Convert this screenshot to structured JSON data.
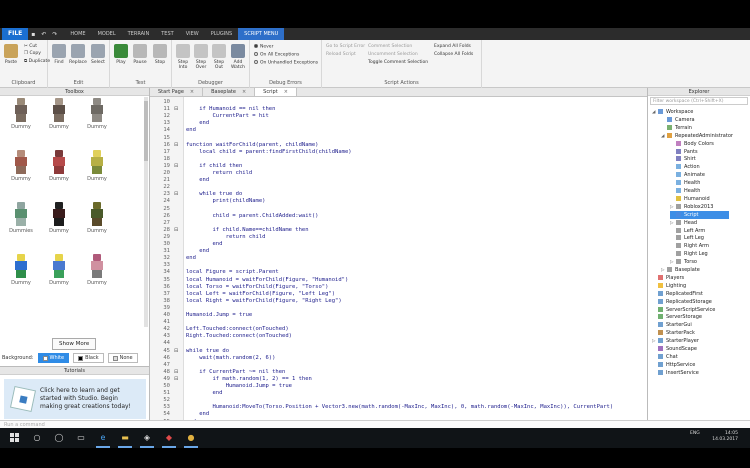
{
  "menubar": {
    "file_label": "FILE",
    "tabs": [
      "HOME",
      "MODEL",
      "TERRAIN",
      "TEST",
      "VIEW",
      "PLUGINS",
      "SCRIPT MENU"
    ]
  },
  "ribbon": {
    "clipboard": {
      "title": "Clipboard",
      "paste": "Paste",
      "cut": "Cut",
      "copy": "Copy",
      "duplicate": "Duplicate"
    },
    "edit": {
      "title": "Edit",
      "find": "Find",
      "replace": "Replace",
      "select": "Select"
    },
    "test": {
      "title": "Test",
      "play": "Play",
      "pause": "Pause",
      "stop": "Stop"
    },
    "debugger": {
      "title": "Debugger",
      "step_into": "Step Into",
      "step_over": "Step Over",
      "step_out": "Step Out",
      "add_watch": "Add Watch"
    },
    "debug_errors": {
      "title": "Debug Errors",
      "never": "Never",
      "on_all": "On All Exceptions",
      "on_unhandled": "On Unhandled Exceptions"
    },
    "actions": {
      "title": "Script Actions",
      "goto": "Go to Script Error",
      "reload": "Reload Script",
      "comment": "Comment Selection",
      "uncomment": "Uncomment Selection",
      "toggle": "Toggle Comment Selection",
      "expand": "Expand All Folds",
      "collapse": "Collapse All Folds"
    }
  },
  "toolbox": {
    "title": "Toolbox",
    "items": [
      {
        "label": "Dummy",
        "head": "#9a8a78",
        "torso": "#6e6058",
        "legs": "#7a6c60"
      },
      {
        "label": "Dummy",
        "head": "#a59688",
        "torso": "#5c4f47",
        "legs": "#7a6c60"
      },
      {
        "label": "Dummy",
        "head": "#8e8a84",
        "torso": "#6e6a64",
        "legs": "#8e8a84"
      },
      {
        "label": "Dummy",
        "head": "#b58c7a",
        "torso": "#a0584a",
        "legs": "#8d6a5a"
      },
      {
        "label": "Dummy",
        "head": "#7a3a3a",
        "torso": "#b64a4a",
        "legs": "#8e3a3a"
      },
      {
        "label": "Dummy",
        "head": "#e0d05a",
        "torso": "#b7b045",
        "legs": "#7a8a3a"
      },
      {
        "label": "Dummies",
        "head": "#8fa5a0",
        "torso": "#5a9070",
        "legs": "#9ab0a8"
      },
      {
        "label": "Dummy",
        "head": "#202020",
        "torso": "#3a1c1c",
        "legs": "#1c1c1c"
      },
      {
        "label": "Dummy",
        "head": "#6a6a2a",
        "torso": "#4a5a2a",
        "legs": "#5a4a2a"
      },
      {
        "label": "Dummy",
        "head": "#e6d44a",
        "torso": "#2e6fcf",
        "legs": "#2e8e4a"
      },
      {
        "label": "Dummy",
        "head": "#e6d44a",
        "torso": "#4a7ad0",
        "legs": "#3aa05a"
      },
      {
        "label": "Dummy",
        "head": "#b05a7a",
        "torso": "#d090a0",
        "legs": "#7a7a7a"
      }
    ],
    "show_more": "Show More",
    "background_label": "Background:",
    "bg_options": [
      "White",
      "Black",
      "None"
    ]
  },
  "tutorials": {
    "title": "Tutorials",
    "text": "Click here to learn and get started with Studio. Begin making great creations today!"
  },
  "editor": {
    "tabs": [
      {
        "label": "Start Page",
        "active": false
      },
      {
        "label": "Baseplate",
        "active": false
      },
      {
        "label": "Script",
        "active": true
      }
    ],
    "first_line": 10,
    "lines": [
      "",
      "    if Humanoid == nil then",
      "        CurrentPart = hit",
      "    end",
      "end",
      "",
      "function waitForChild(parent, childName)",
      "    local child = parent:findFirstChild(childName)",
      "",
      "    if child then",
      "        return child",
      "    end",
      "",
      "    while true do",
      "        print(childName)",
      "",
      "        child = parent.ChildAdded:wait()",
      "",
      "        if child.Name==childName then",
      "            return child",
      "        end",
      "    end",
      "end",
      "",
      "local Figure = script.Parent",
      "local Humanoid = waitForChild(Figure, \"Humanoid\")",
      "local Torso = waitForChild(Figure, \"Torso\")",
      "local Left = waitForChild(Figure, \"Left Leg\")",
      "local Right = waitForChild(Figure, \"Right Leg\")",
      "",
      "Humanoid.Jump = true",
      "",
      "Left.Touched:connect(onTouched)",
      "Right.Touched:connect(onTouched)",
      "",
      "while true do",
      "    wait(math.random(2, 6))",
      "",
      "    if CurrentPart ~= nil then",
      "        if math.random(1, 2) == 1 then",
      "            Humanoid.Jump = true",
      "        end",
      "",
      "        Humanoid:MoveTo(Torso.Position + Vector3.new(math.random(-MaxInc, MaxInc), 0, math.random(-MaxInc, MaxInc)), CurrentPart)",
      "    end",
      "end",
      ""
    ]
  },
  "explorer": {
    "title": "Explorer",
    "filter_placeholder": "Filter workspace (Ctrl+Shift+X)",
    "items": [
      {
        "label": "Workspace",
        "depth": 0,
        "exp": "◢",
        "color": "#6a9ad8"
      },
      {
        "label": "Camera",
        "depth": 1,
        "exp": "",
        "color": "#6a9ad8"
      },
      {
        "label": "Terrain",
        "depth": 1,
        "exp": "",
        "color": "#7ab070"
      },
      {
        "label": "RepeatedAdministrator",
        "depth": 1,
        "exp": "◢",
        "color": "#e0a040"
      },
      {
        "label": "Body Colors",
        "depth": 2,
        "exp": "",
        "color": "#c080c0"
      },
      {
        "label": "Pants",
        "depth": 2,
        "exp": "",
        "color": "#8080c0"
      },
      {
        "label": "Shirt",
        "depth": 2,
        "exp": "",
        "color": "#8080c0"
      },
      {
        "label": "Action",
        "depth": 2,
        "exp": "",
        "color": "#7ab0e0"
      },
      {
        "label": "Animate",
        "depth": 2,
        "exp": "",
        "color": "#7ab0e0"
      },
      {
        "label": "Health",
        "depth": 2,
        "exp": "",
        "color": "#7ab0e0"
      },
      {
        "label": "Health",
        "depth": 2,
        "exp": "",
        "color": "#7ab0e0"
      },
      {
        "label": "Humanoid",
        "depth": 2,
        "exp": "",
        "color": "#e0c040"
      },
      {
        "label": "Roblox2013",
        "depth": 2,
        "exp": "▷",
        "color": "#a0a0a0"
      },
      {
        "label": "Script",
        "depth": 2,
        "exp": "",
        "color": "#4a8ae0",
        "sel": true
      },
      {
        "label": "Head",
        "depth": 2,
        "exp": "▷",
        "color": "#a0a0a0"
      },
      {
        "label": "Left Arm",
        "depth": 2,
        "exp": "",
        "color": "#a0a0a0"
      },
      {
        "label": "Left Leg",
        "depth": 2,
        "exp": "",
        "color": "#a0a0a0"
      },
      {
        "label": "Right Arm",
        "depth": 2,
        "exp": "",
        "color": "#a0a0a0"
      },
      {
        "label": "Right Leg",
        "depth": 2,
        "exp": "",
        "color": "#a0a0a0"
      },
      {
        "label": "Torso",
        "depth": 2,
        "exp": "▷",
        "color": "#a0a0a0"
      },
      {
        "label": "Baseplate",
        "depth": 1,
        "exp": "▷",
        "color": "#a0a0a0"
      },
      {
        "label": "Players",
        "depth": 0,
        "exp": "",
        "color": "#e07070"
      },
      {
        "label": "Lighting",
        "depth": 0,
        "exp": "",
        "color": "#f0c040"
      },
      {
        "label": "ReplicatedFirst",
        "depth": 0,
        "exp": "",
        "color": "#70a0d0"
      },
      {
        "label": "ReplicatedStorage",
        "depth": 0,
        "exp": "",
        "color": "#70a0d0"
      },
      {
        "label": "ServerScriptService",
        "depth": 0,
        "exp": "",
        "color": "#70b070"
      },
      {
        "label": "ServerStorage",
        "depth": 0,
        "exp": "",
        "color": "#70b070"
      },
      {
        "label": "StarterGui",
        "depth": 0,
        "exp": "",
        "color": "#70a0d0"
      },
      {
        "label": "StarterPack",
        "depth": 0,
        "exp": "",
        "color": "#c09050"
      },
      {
        "label": "StarterPlayer",
        "depth": 0,
        "exp": "▷",
        "color": "#70a0d0"
      },
      {
        "label": "SoundScape",
        "depth": 0,
        "exp": "",
        "color": "#a070c0"
      },
      {
        "label": "Chat",
        "depth": 0,
        "exp": "",
        "color": "#70a0d0"
      },
      {
        "label": "HttpService",
        "depth": 0,
        "exp": "",
        "color": "#70a0d0"
      },
      {
        "label": "InsertService",
        "depth": 0,
        "exp": "",
        "color": "#70a0d0"
      }
    ]
  },
  "command_bar": {
    "placeholder": "Run a command"
  },
  "taskbar": {
    "icons": [
      "search-icon",
      "cortana-icon",
      "task-view-icon",
      "edge-icon",
      "folder-icon",
      "store-icon",
      "studio-icon",
      "chrome-icon"
    ],
    "tray_lang": "ENG",
    "time": "14:05",
    "date": "14.03.2017"
  }
}
